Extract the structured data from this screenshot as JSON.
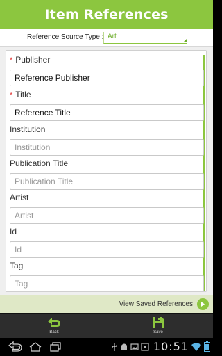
{
  "header": {
    "title": "Item References"
  },
  "reference_type": {
    "label": "Reference Source Type :",
    "value": "Art"
  },
  "fields": [
    {
      "label": "Publisher",
      "required": true,
      "value": "Reference Publisher"
    },
    {
      "label": "Title",
      "required": true,
      "value": "Reference Title"
    },
    {
      "label": "Institution",
      "required": false,
      "placeholder": "Institution"
    },
    {
      "label": "Publication Title",
      "required": false,
      "placeholder": "Publication Title"
    },
    {
      "label": "Artist",
      "required": false,
      "placeholder": "Artist"
    },
    {
      "label": "Id",
      "required": false,
      "placeholder": "Id"
    },
    {
      "label": "Tag",
      "required": false,
      "placeholder": "Tag"
    }
  ],
  "required_marker": "*",
  "saved_link": {
    "label": "View Saved References"
  },
  "actions": {
    "back_label": "Back",
    "save_label": "Save"
  },
  "status": {
    "time": "10:51"
  },
  "colors": {
    "accent": "#8cc63f",
    "required": "#e23b3b",
    "saved_bar": "#dfe8c6"
  }
}
